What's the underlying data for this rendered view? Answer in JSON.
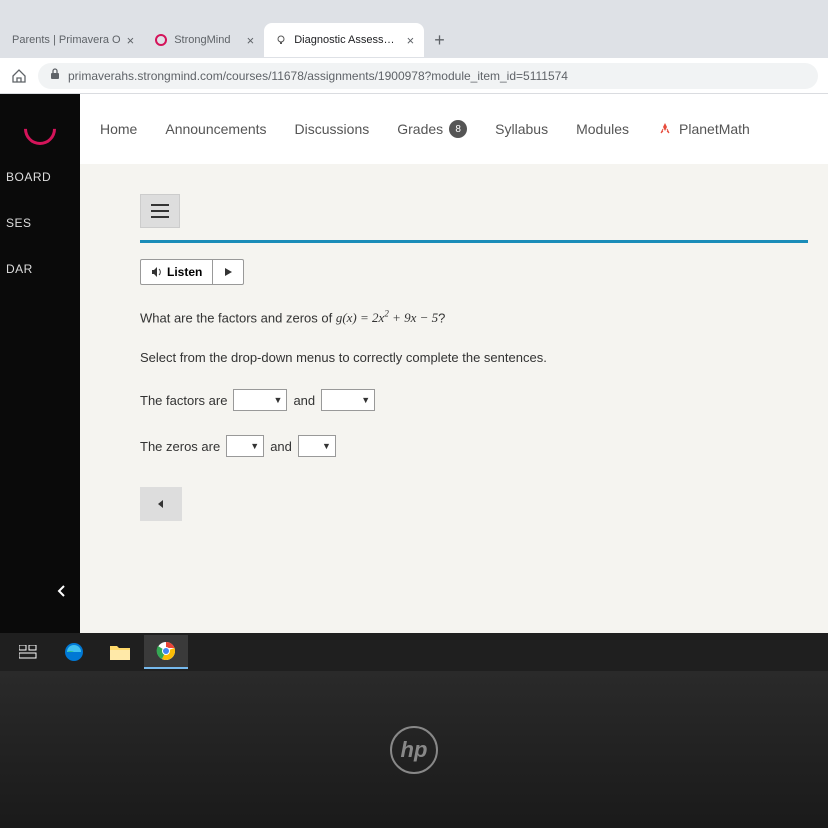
{
  "browser": {
    "tabs": [
      {
        "title": "Parents | Primavera O"
      },
      {
        "title": "StrongMind"
      },
      {
        "title": "Diagnostic Assessment"
      }
    ],
    "url": "primaverahs.strongmind.com/courses/11678/assignments/1900978?module_item_id=5111574"
  },
  "sidebar": {
    "items": [
      "BOARD",
      "SES",
      "DAR"
    ]
  },
  "topnav": {
    "home": "Home",
    "announcements": "Announcements",
    "discussions": "Discussions",
    "grades": "Grades",
    "grades_badge": "8",
    "syllabus": "Syllabus",
    "modules": "Modules",
    "planetmath": "PlanetMath"
  },
  "content": {
    "listen": "Listen",
    "question_lead": "What are the factors and zeros of ",
    "question_tail": "?",
    "math_g": "g",
    "math_x": "(x)",
    "math_eq": " = 2",
    "math_x2": "x",
    "math_plus": " + 9",
    "math_x3": "x",
    "math_minus": " − 5",
    "instruction": "Select from the drop-down menus to correctly complete the sentences.",
    "factors_lead": "The factors are",
    "and": "and",
    "zeros_lead": "The zeros are"
  },
  "laptop": {
    "brand": "hp"
  }
}
